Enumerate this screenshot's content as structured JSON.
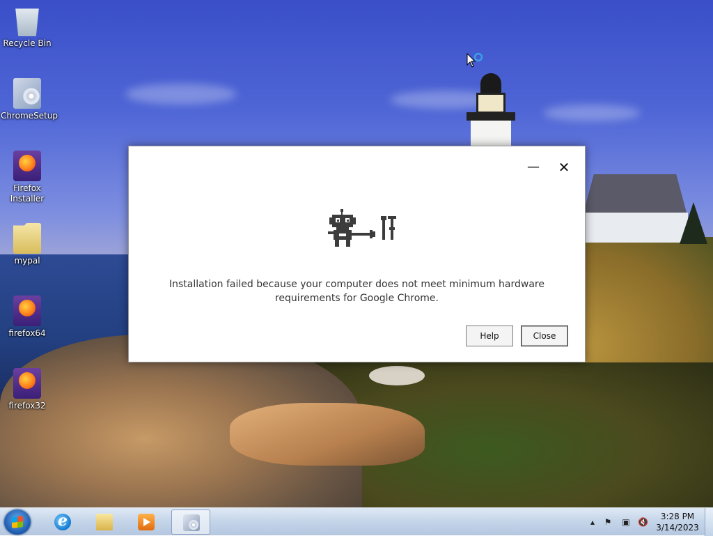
{
  "desktop": {
    "icons": [
      {
        "label": "Recycle Bin",
        "icon": "recycle-bin-icon"
      },
      {
        "label": "ChromeSetup",
        "icon": "installer-icon"
      },
      {
        "label": "Firefox Installer",
        "icon": "firefox-installer-icon"
      },
      {
        "label": "mypal",
        "icon": "folder-icon"
      },
      {
        "label": "firefox64",
        "icon": "firefox-installer-icon"
      },
      {
        "label": "firefox32",
        "icon": "firefox-installer-icon"
      }
    ]
  },
  "dialog": {
    "message": "Installation failed because your computer does not meet minimum hardware requirements for Google Chrome.",
    "help_label": "Help",
    "close_label": "Close",
    "minimize_glyph": "—",
    "close_glyph": "✕"
  },
  "taskbar": {
    "pinned": [
      {
        "name": "Internet Explorer",
        "icon": "internet-explorer-icon"
      },
      {
        "name": "Windows Explorer",
        "icon": "folder-icon"
      },
      {
        "name": "Windows Media Player",
        "icon": "media-player-icon"
      },
      {
        "name": "ChromeSetup",
        "icon": "installer-icon",
        "active": true
      }
    ],
    "tray": {
      "time": "3:28 PM",
      "date": "3/14/2023"
    }
  },
  "colors": {
    "dialog_bg": "#ffffff",
    "taskbar_top": "#dfe9f5",
    "desktop_sky": "#3a4fc8"
  }
}
